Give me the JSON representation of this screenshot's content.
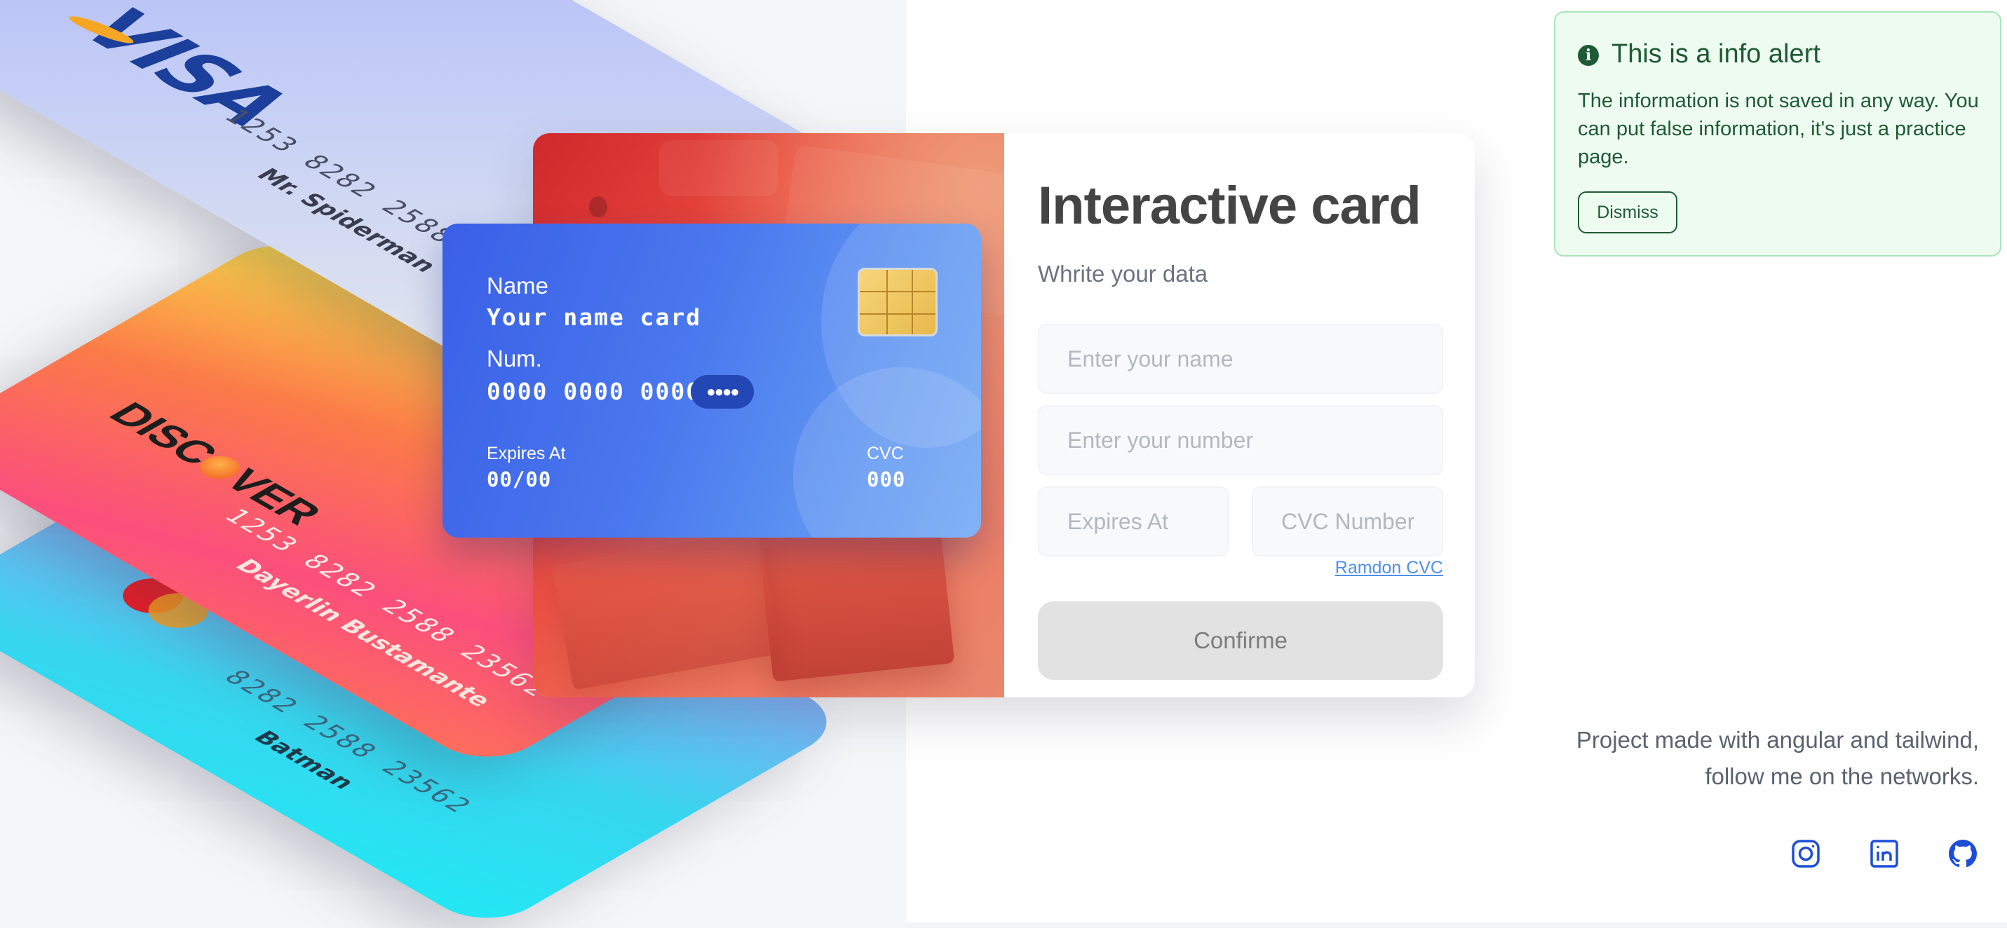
{
  "showcase_cards": {
    "visa": {
      "brand": "VISA",
      "number": "1253 8282 2588",
      "holder": "Mr. Spiderman"
    },
    "discover": {
      "brand_prefix": "DISC",
      "brand_suffix": "VER",
      "number": "1253 8282 2588 23562",
      "holder": "Dayerlin Bustamante"
    },
    "master": {
      "number": "8282 2588 23562",
      "holder": "Batman"
    }
  },
  "preview_card": {
    "name_label": "Name",
    "name_value": "Your name card",
    "number_label": "Num.",
    "number_value": "0000 0000 0000",
    "number_mask": "●●●●",
    "expires_label": "Expires At",
    "expires_value": "00/00",
    "cvc_label": "CVC",
    "cvc_value": "000"
  },
  "form": {
    "title": "Interactive card",
    "subtitle": "Whrite your data",
    "name_placeholder": "Enter your name",
    "number_placeholder": "Enter your number",
    "expires_placeholder": "Expires At",
    "cvc_placeholder": "CVC Number",
    "random_cvc_link": "Ramdon CVC",
    "confirm_label": "Confirme"
  },
  "alert": {
    "title": "This is a info alert",
    "text": "The information is not saved in any way. You can put false information, it's just a practice page.",
    "dismiss_label": "Dismiss",
    "icon": "info-icon"
  },
  "footer": {
    "line1": "Project made with angular and tailwind,",
    "line2": "follow me on the networks.",
    "socials": [
      "instagram-icon",
      "linkedin-icon",
      "github-icon"
    ]
  },
  "colors": {
    "accent_blue": "#3a5fe6",
    "alert_green": "#1e5a35",
    "alert_bg": "#eefbf1",
    "link_blue": "#4f8fe8"
  }
}
